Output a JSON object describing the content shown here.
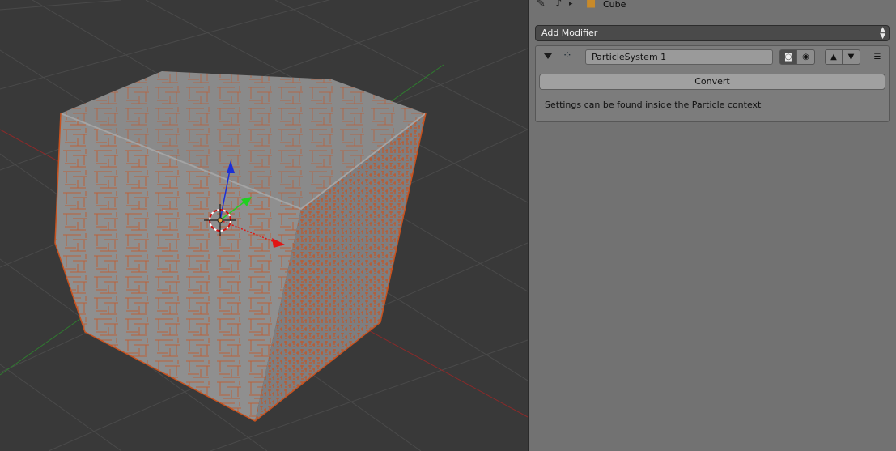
{
  "breadcrumb": {
    "pin_icon": "pin-icon",
    "scene_icon": "object-data-icon",
    "separator": "▸",
    "object_icon": "cube-icon",
    "object_name": "Cube"
  },
  "modifiers": {
    "add_modifier_label": "Add Modifier",
    "particle_system": {
      "icon": "particles-icon",
      "name": "ParticleSystem 1",
      "convert_label": "Convert",
      "info_text": "Settings can be found inside the Particle context"
    }
  },
  "viewport": {
    "object": "Cube",
    "particle_color": "#c9521e",
    "cube_color": "#8f8f8f",
    "axis_colors": {
      "x": "#e01515",
      "y": "#20d020",
      "z": "#1b2fd8"
    }
  }
}
